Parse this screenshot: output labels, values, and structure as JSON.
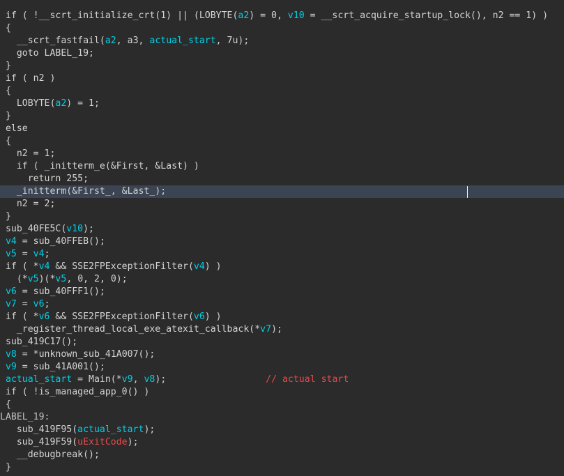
{
  "editor": {
    "caret_line": 15,
    "lines": [
      [
        {
          "t": " if ( !__scrt_initialize_crt(1) || (LOBYTE(",
          "c": "default"
        },
        {
          "t": "a2",
          "c": "var"
        },
        {
          "t": ") = 0, ",
          "c": "default"
        },
        {
          "t": "v10",
          "c": "var"
        },
        {
          "t": " = __scrt_acquire_startup_lock(), n2 == 1) )",
          "c": "default"
        }
      ],
      [
        {
          "t": " {",
          "c": "default"
        }
      ],
      [
        {
          "t": "   __scrt_fastfail(",
          "c": "default"
        },
        {
          "t": "a2",
          "c": "var"
        },
        {
          "t": ", a3, ",
          "c": "default"
        },
        {
          "t": "actual_start",
          "c": "var"
        },
        {
          "t": ", 7u);",
          "c": "default"
        }
      ],
      [
        {
          "t": "   goto LABEL_19;",
          "c": "default"
        }
      ],
      [
        {
          "t": " }",
          "c": "default"
        }
      ],
      [
        {
          "t": " if ( n2 )",
          "c": "default"
        }
      ],
      [
        {
          "t": " {",
          "c": "default"
        }
      ],
      [
        {
          "t": "   LOBYTE(",
          "c": "default"
        },
        {
          "t": "a2",
          "c": "var"
        },
        {
          "t": ") = 1;",
          "c": "default"
        }
      ],
      [
        {
          "t": " }",
          "c": "default"
        }
      ],
      [
        {
          "t": " else",
          "c": "default"
        }
      ],
      [
        {
          "t": " {",
          "c": "default"
        }
      ],
      [
        {
          "t": "   n2 = 1;",
          "c": "default"
        }
      ],
      [
        {
          "t": "   if ( _initterm_e(&First, &Last) )",
          "c": "default"
        }
      ],
      [
        {
          "t": "     return 255;",
          "c": "default"
        }
      ],
      [
        {
          "t": "   _initterm(&First_, &Last_);",
          "c": "default"
        }
      ],
      [
        {
          "t": "   n2 = 2;",
          "c": "default"
        }
      ],
      [
        {
          "t": " }",
          "c": "default"
        }
      ],
      [
        {
          "t": " sub_40FE5C(",
          "c": "default"
        },
        {
          "t": "v10",
          "c": "var"
        },
        {
          "t": ");",
          "c": "default"
        }
      ],
      [
        {
          "t": " ",
          "c": "default"
        },
        {
          "t": "v4",
          "c": "var"
        },
        {
          "t": " = sub_40FFEB();",
          "c": "default"
        }
      ],
      [
        {
          "t": " ",
          "c": "default"
        },
        {
          "t": "v5",
          "c": "var"
        },
        {
          "t": " = ",
          "c": "default"
        },
        {
          "t": "v4",
          "c": "var"
        },
        {
          "t": ";",
          "c": "default"
        }
      ],
      [
        {
          "t": " if ( *",
          "c": "default"
        },
        {
          "t": "v4",
          "c": "var"
        },
        {
          "t": " && SSE2FPExceptionFilter(",
          "c": "default"
        },
        {
          "t": "v4",
          "c": "var"
        },
        {
          "t": ") )",
          "c": "default"
        }
      ],
      [
        {
          "t": "   (*",
          "c": "default"
        },
        {
          "t": "v5",
          "c": "var"
        },
        {
          "t": ")(*",
          "c": "default"
        },
        {
          "t": "v5",
          "c": "var"
        },
        {
          "t": ", 0, 2, 0);",
          "c": "default"
        }
      ],
      [
        {
          "t": " ",
          "c": "default"
        },
        {
          "t": "v6",
          "c": "var"
        },
        {
          "t": " = sub_40FFF1();",
          "c": "default"
        }
      ],
      [
        {
          "t": " ",
          "c": "default"
        },
        {
          "t": "v7",
          "c": "var"
        },
        {
          "t": " = ",
          "c": "default"
        },
        {
          "t": "v6",
          "c": "var"
        },
        {
          "t": ";",
          "c": "default"
        }
      ],
      [
        {
          "t": " if ( *",
          "c": "default"
        },
        {
          "t": "v6",
          "c": "var"
        },
        {
          "t": " && SSE2FPExceptionFilter(",
          "c": "default"
        },
        {
          "t": "v6",
          "c": "var"
        },
        {
          "t": ") )",
          "c": "default"
        }
      ],
      [
        {
          "t": "   _register_thread_local_exe_atexit_callback(*",
          "c": "default"
        },
        {
          "t": "v7",
          "c": "var"
        },
        {
          "t": ");",
          "c": "default"
        }
      ],
      [
        {
          "t": " sub_419C17();",
          "c": "default"
        }
      ],
      [
        {
          "t": " ",
          "c": "default"
        },
        {
          "t": "v8",
          "c": "var"
        },
        {
          "t": " = *unknown_sub_41A007();",
          "c": "default"
        }
      ],
      [
        {
          "t": " ",
          "c": "default"
        },
        {
          "t": "v9",
          "c": "var"
        },
        {
          "t": " = sub_41A001();",
          "c": "default"
        }
      ],
      [
        {
          "t": " ",
          "c": "default"
        },
        {
          "t": "actual_start",
          "c": "var"
        },
        {
          "t": " = Main(*",
          "c": "default"
        },
        {
          "t": "v9",
          "c": "var"
        },
        {
          "t": ", ",
          "c": "default"
        },
        {
          "t": "v8",
          "c": "var"
        },
        {
          "t": ");                  ",
          "c": "default"
        },
        {
          "t": "// actual start",
          "c": "comment"
        }
      ],
      [
        {
          "t": " if ( !is_managed_app_0() )",
          "c": "default"
        }
      ],
      [
        {
          "t": " {",
          "c": "default"
        }
      ],
      [
        {
          "t": "LABEL_19:",
          "c": "label"
        }
      ],
      [
        {
          "t": "   sub_419F95(",
          "c": "default"
        },
        {
          "t": "actual_start",
          "c": "var"
        },
        {
          "t": ");",
          "c": "default"
        }
      ],
      [
        {
          "t": "   sub_419F59(",
          "c": "default"
        },
        {
          "t": "uExitCode",
          "c": "red"
        },
        {
          "t": ");",
          "c": "default"
        }
      ],
      [
        {
          "t": "   __debugbreak();",
          "c": "default"
        }
      ],
      [
        {
          "t": " }",
          "c": "default"
        }
      ]
    ]
  }
}
